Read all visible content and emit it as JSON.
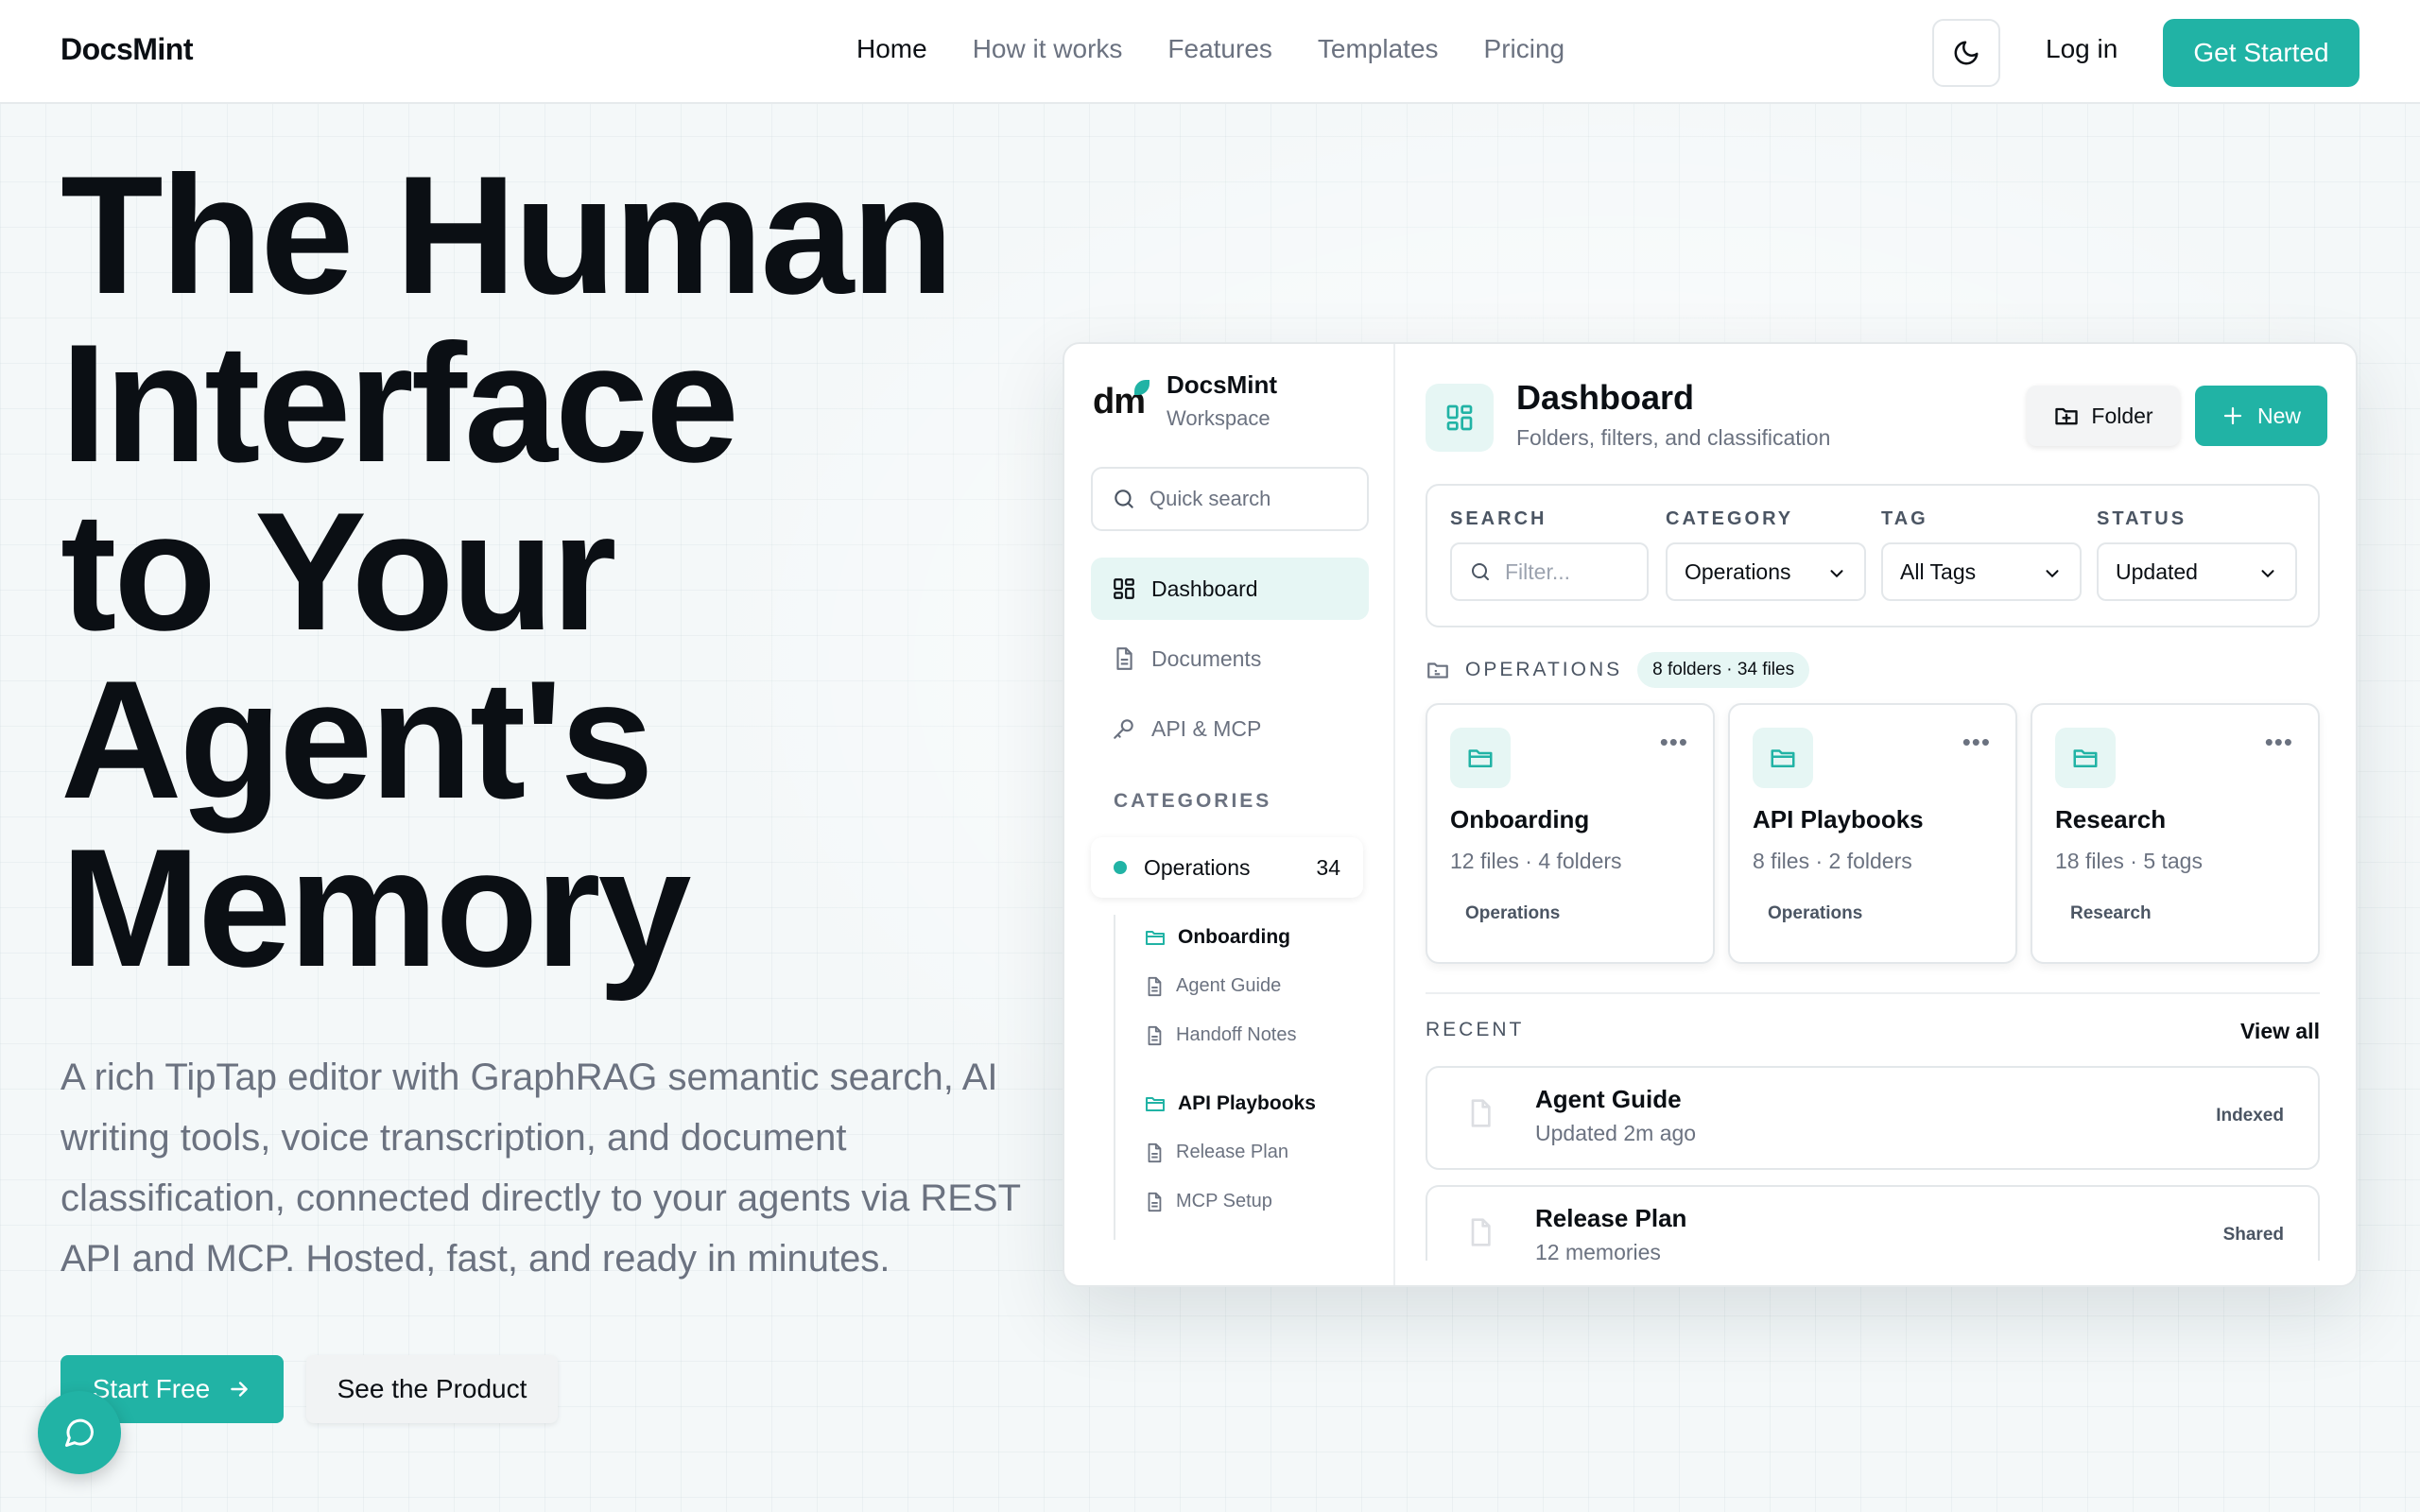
{
  "nav": {
    "brand": "DocsMint",
    "links": [
      "Home",
      "How it works",
      "Features",
      "Templates",
      "Pricing"
    ],
    "login": "Log in",
    "get_started": "Get Started"
  },
  "hero": {
    "title_lines": [
      "The Human",
      "Interface",
      "to Your",
      "Agent's",
      "Memory"
    ],
    "subtitle": "A rich TipTap editor with GraphRAG semantic search, AI writing tools, voice transcription, and document classification, connected directly to your agents via REST API and MCP. Hosted, fast, and ready in minutes.",
    "start_free": "Start Free",
    "see_product": "See the Product"
  },
  "app": {
    "logo": "dm",
    "workspace_name": "DocsMint",
    "workspace_sub": "Workspace",
    "quick_search": "Quick search",
    "nav": [
      "Dashboard",
      "Documents",
      "API & MCP"
    ],
    "categories_heading": "CATEGORIES",
    "category": {
      "name": "Operations",
      "count": "34"
    },
    "tree": [
      {
        "label": "Onboarding",
        "type": "folder"
      },
      {
        "label": "Agent Guide",
        "type": "doc"
      },
      {
        "label": "Handoff Notes",
        "type": "doc"
      },
      {
        "label": "API Playbooks",
        "type": "folder"
      },
      {
        "label": "Release Plan",
        "type": "doc"
      },
      {
        "label": "MCP Setup",
        "type": "doc"
      }
    ],
    "main": {
      "title": "Dashboard",
      "subtitle": "Folders, filters, and classification",
      "folder_btn": "Folder",
      "new_btn": "New",
      "filters": {
        "search_label": "SEARCH",
        "search_placeholder": "Filter...",
        "category_label": "CATEGORY",
        "category_value": "Operations",
        "tag_label": "TAG",
        "tag_value": "All Tags",
        "status_label": "STATUS",
        "status_value": "Updated"
      },
      "section_heading": "OPERATIONS",
      "section_badge": "8 folders · 34 files",
      "cards": [
        {
          "title": "Onboarding",
          "meta": "12 files · 4 folders",
          "category": "Operations"
        },
        {
          "title": "API Playbooks",
          "meta": "8 files · 2 folders",
          "category": "Operations"
        },
        {
          "title": "Research",
          "meta": "18 files · 5 tags",
          "category": "Research"
        }
      ],
      "recent_heading": "RECENT",
      "view_all": "View all",
      "recent": [
        {
          "title": "Agent Guide",
          "sub": "Updated 2m ago",
          "badge": "Indexed"
        },
        {
          "title": "Release Plan",
          "sub": "12 memories",
          "badge": "Shared"
        }
      ]
    }
  },
  "colors": {
    "accent": "#21b3a5",
    "accent_soft": "#e6f6f4",
    "text": "#0b0f14",
    "muted": "#6b7280"
  },
  "icons": [
    "moon-icon",
    "arrow-right-icon",
    "chat-icon",
    "search-icon",
    "dashboard-icon",
    "document-icon",
    "key-icon",
    "folder-icon",
    "folder-plus-icon",
    "plus-icon",
    "chevron-down-icon",
    "more-icon"
  ]
}
